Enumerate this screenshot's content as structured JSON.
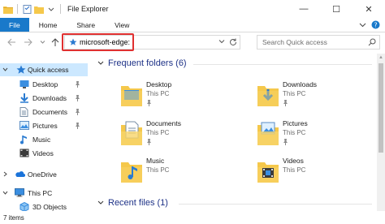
{
  "window": {
    "title": "File Explorer",
    "controls": {
      "minimize": "—",
      "maximize": "☐",
      "close": "✕"
    }
  },
  "ribbon": {
    "tabs": [
      "File",
      "Home",
      "Share",
      "View"
    ]
  },
  "address": {
    "value": "microsoft-edge:",
    "search_placeholder": "Search Quick access",
    "highlight_color": "#e03030"
  },
  "nav": {
    "items": [
      {
        "label": "Quick access",
        "icon": "star-icon",
        "selected": true
      },
      {
        "label": "Desktop",
        "icon": "desktop-folder-icon",
        "pinned": true
      },
      {
        "label": "Downloads",
        "icon": "downloads-folder-icon",
        "pinned": true
      },
      {
        "label": "Documents",
        "icon": "documents-folder-icon",
        "pinned": true
      },
      {
        "label": "Pictures",
        "icon": "pictures-folder-icon",
        "pinned": true
      },
      {
        "label": "Music",
        "icon": "music-folder-icon"
      },
      {
        "label": "Videos",
        "icon": "videos-folder-icon"
      },
      {
        "label": "OneDrive",
        "icon": "onedrive-cloud-icon"
      },
      {
        "label": "This PC",
        "icon": "computer-icon"
      },
      {
        "label": "3D Objects",
        "icon": "3d-objects-folder-icon"
      }
    ]
  },
  "content": {
    "frequent_header": "Frequent folders (6)",
    "recent_header": "Recent files (1)",
    "folders": [
      {
        "name": "Desktop",
        "location": "This PC",
        "icon": "desktop-folder-icon",
        "pinned": true
      },
      {
        "name": "Downloads",
        "location": "This PC",
        "icon": "downloads-folder-icon",
        "pinned": true
      },
      {
        "name": "Documents",
        "location": "This PC",
        "icon": "documents-folder-icon",
        "pinned": true
      },
      {
        "name": "Pictures",
        "location": "This PC",
        "icon": "pictures-folder-icon",
        "pinned": true
      },
      {
        "name": "Music",
        "location": "This PC",
        "icon": "music-folder-icon",
        "pinned": false
      },
      {
        "name": "Videos",
        "location": "This PC",
        "icon": "videos-folder-icon",
        "pinned": false
      }
    ]
  },
  "status": {
    "item_count": "7 items"
  },
  "colors": {
    "accent": "#1979ca",
    "folder": "#f5c84b",
    "section_title": "#1e3287",
    "selected_bg": "#cce8ff"
  }
}
